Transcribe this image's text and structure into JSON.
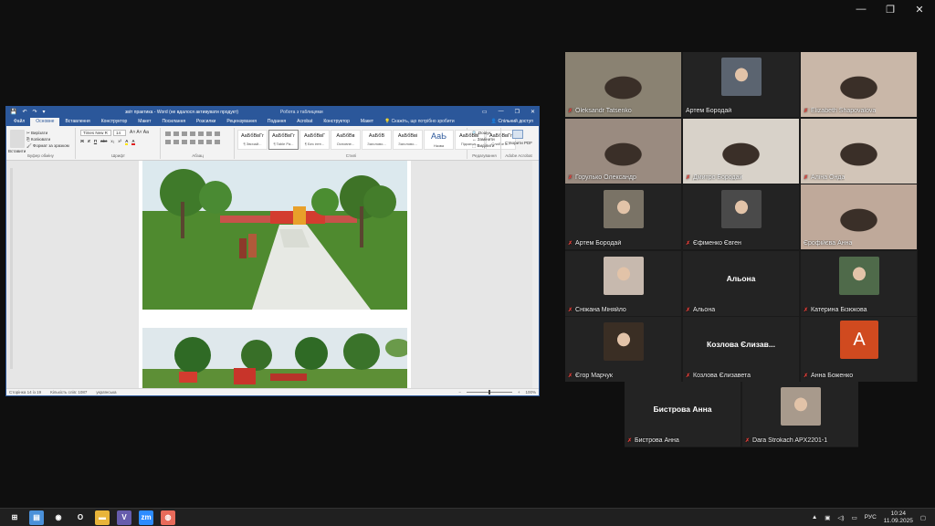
{
  "desktop": {
    "window_controls": [
      "—",
      "❐",
      "✕"
    ]
  },
  "word": {
    "doc_title": "звіт практика - Word (не вдалося активувати продукт)",
    "context_label": "Робота з таблицями",
    "quick_access": [
      "💾",
      "↶",
      "↷",
      "▾"
    ],
    "window_controls": [
      "▭",
      "—",
      "❐",
      "✕"
    ],
    "tabs": [
      "Файл",
      "Основне",
      "Вставлення",
      "Конструктор",
      "Макет",
      "Посилання",
      "Розсилки",
      "Рецензування",
      "Подання",
      "Acrobat",
      "Конструктор",
      "Макет"
    ],
    "active_tab": 1,
    "tell_me": "Скажіть, що потрібно зробити",
    "share": "Спільний доступ",
    "clipboard": {
      "paste": "Вставити",
      "cut": "Вирізати",
      "copy": "Копіювати",
      "format_painter": "Формат за зразком",
      "label": "Буфер обміну"
    },
    "font": {
      "name": "Times New R",
      "size": "14",
      "label": "Шрифт",
      "format_buttons": [
        "Ж",
        "К",
        "П",
        "abc",
        "x₂",
        "x²",
        "A",
        "A"
      ]
    },
    "paragraph": {
      "label": "Абзац"
    },
    "styles": {
      "label": "Стилі",
      "items": [
        {
          "sample": "АаБбВвГг",
          "name": "¶ Звичай..."
        },
        {
          "sample": "АаБбВвГг",
          "name": "¶ Table Pa..."
        },
        {
          "sample": "АаБбВвГ",
          "name": "¶ Без інте..."
        },
        {
          "sample": "АаБбВв",
          "name": "Основне..."
        },
        {
          "sample": "АаБбВ",
          "name": "Заголово..."
        },
        {
          "sample": "АаБбВві",
          "name": "Заголово..."
        },
        {
          "sample": "АаЬ",
          "name": "Назва"
        },
        {
          "sample": "АаБбВвГ",
          "name": "Підзагол..."
        },
        {
          "sample": "АаБбВвГг",
          "name": "Слабке в..."
        }
      ]
    },
    "editing": {
      "find": "Пошук",
      "replace": "Замінити",
      "select": "Виділити",
      "label": "Редагування"
    },
    "acrobat": {
      "create_pdf": "Створити PDF",
      "label": "Adobe Acrobat"
    },
    "status": {
      "page": "Сторінка 14 із 19",
      "words": "Кількість слів: 1087",
      "language": "українська",
      "zoom": "100%"
    }
  },
  "zoom": {
    "participants": [
      {
        "name": "Oleksandr Tatsenko",
        "muted": true,
        "type": "video",
        "bg": "#8a8272"
      },
      {
        "name": "Артем Бородай",
        "muted": false,
        "type": "thumb",
        "bg": "#5b6470"
      },
      {
        "name": "Elizabeth Shapovalova",
        "muted": true,
        "type": "video",
        "bg": "#c9b7a8"
      },
      {
        "name": "Горулько Олександр",
        "muted": true,
        "type": "video",
        "bg": "#9a8b80"
      },
      {
        "name": "Дмитро Бородай",
        "muted": true,
        "type": "video",
        "bg": "#d8d2c9"
      },
      {
        "name": "Аліна Онда",
        "muted": true,
        "type": "video",
        "bg": "#d2c5b8"
      },
      {
        "name": "Артем Бородай",
        "muted": true,
        "type": "thumb",
        "bg": "#7a7366"
      },
      {
        "name": "Єфіменко Євген",
        "muted": true,
        "type": "thumb",
        "bg": "#4a4a4a"
      },
      {
        "name": "Єрофійєва Анна",
        "muted": false,
        "type": "video",
        "bg": "#bfa99a",
        "active": true
      },
      {
        "name": "Сніжана Міняйло",
        "muted": true,
        "type": "thumb",
        "bg": "#c7b9ae"
      },
      {
        "name": "Альона",
        "muted": true,
        "type": "text",
        "big": "Альона"
      },
      {
        "name": "Катерина Бізюкова",
        "muted": true,
        "type": "thumb",
        "bg": "#4f6a4a"
      },
      {
        "name": "Єгор Марчук",
        "muted": true,
        "type": "thumb",
        "bg": "#3a2e24"
      },
      {
        "name": "Козлова Єлизавета",
        "muted": true,
        "type": "text",
        "big": "Козлова Єлизав..."
      },
      {
        "name": "Анна Боженко",
        "muted": true,
        "type": "letter",
        "letter": "A"
      }
    ],
    "extra": [
      {
        "name": "Бистрова Анна",
        "muted": true,
        "type": "text",
        "big": "Бистрова Анна"
      },
      {
        "name": "Dara Strokach APX2201-1",
        "muted": true,
        "type": "thumb",
        "bg": "#a89a8c"
      }
    ]
  },
  "taskbar": {
    "icons": [
      {
        "name": "windows-start-icon",
        "glyph": "⊞",
        "bg": "transparent"
      },
      {
        "name": "notepad-icon",
        "glyph": "▤",
        "bg": "#4a90d9"
      },
      {
        "name": "chrome-icon",
        "glyph": "◉",
        "bg": "transparent"
      },
      {
        "name": "opera-icon",
        "glyph": "O",
        "bg": "transparent"
      },
      {
        "name": "file-explorer-icon",
        "glyph": "▬",
        "bg": "#e8b43a"
      },
      {
        "name": "viber-icon",
        "glyph": "V",
        "bg": "#665cac"
      },
      {
        "name": "zoom-app-icon",
        "glyph": "zm",
        "bg": "#2d8cff"
      },
      {
        "name": "paint-app-icon",
        "glyph": "◍",
        "bg": "#e86a5a"
      }
    ],
    "tray": {
      "chevron": "▲",
      "network": "▣",
      "volume": "◁)",
      "battery": "▭",
      "language": "РУС",
      "time": "10:24",
      "date": "11.09.2025",
      "notifications": "▢"
    }
  }
}
